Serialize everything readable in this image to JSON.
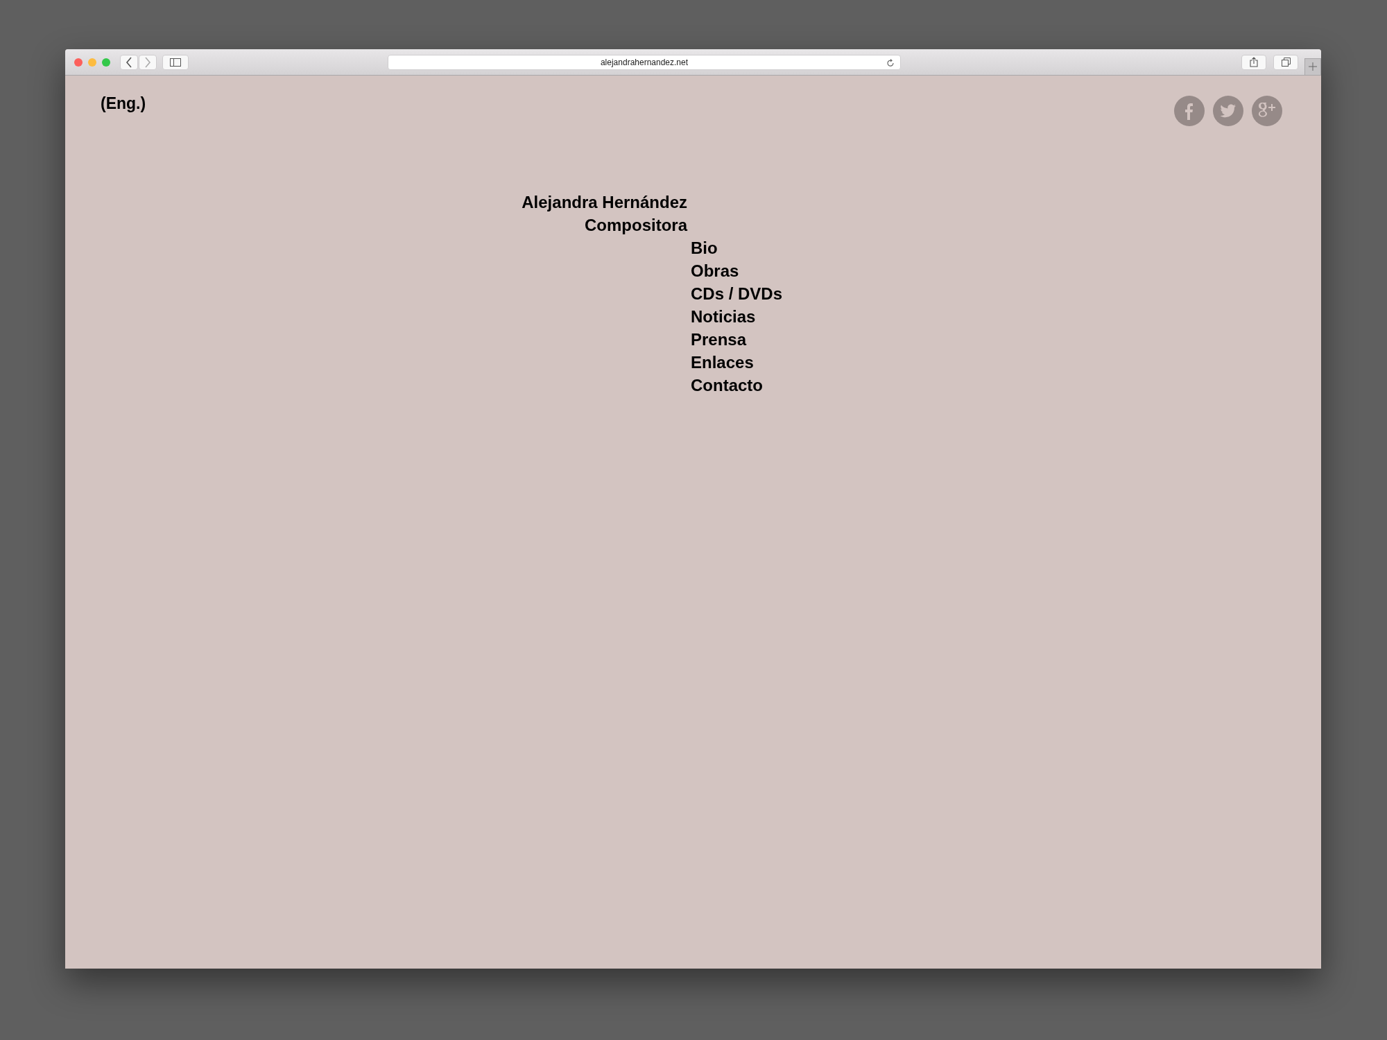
{
  "browser": {
    "url": "alejandrahernandez.net"
  },
  "language_link": "(Eng.)",
  "social": [
    {
      "kind": "facebook"
    },
    {
      "kind": "twitter"
    },
    {
      "kind": "googleplus"
    }
  ],
  "site_title": "Alejandra Hernández",
  "subtitle": "Compositora",
  "nav": [
    "Bio",
    "Obras",
    "CDs / DVDs",
    "Noticias",
    "Prensa",
    "Enlaces",
    "Contacto"
  ]
}
